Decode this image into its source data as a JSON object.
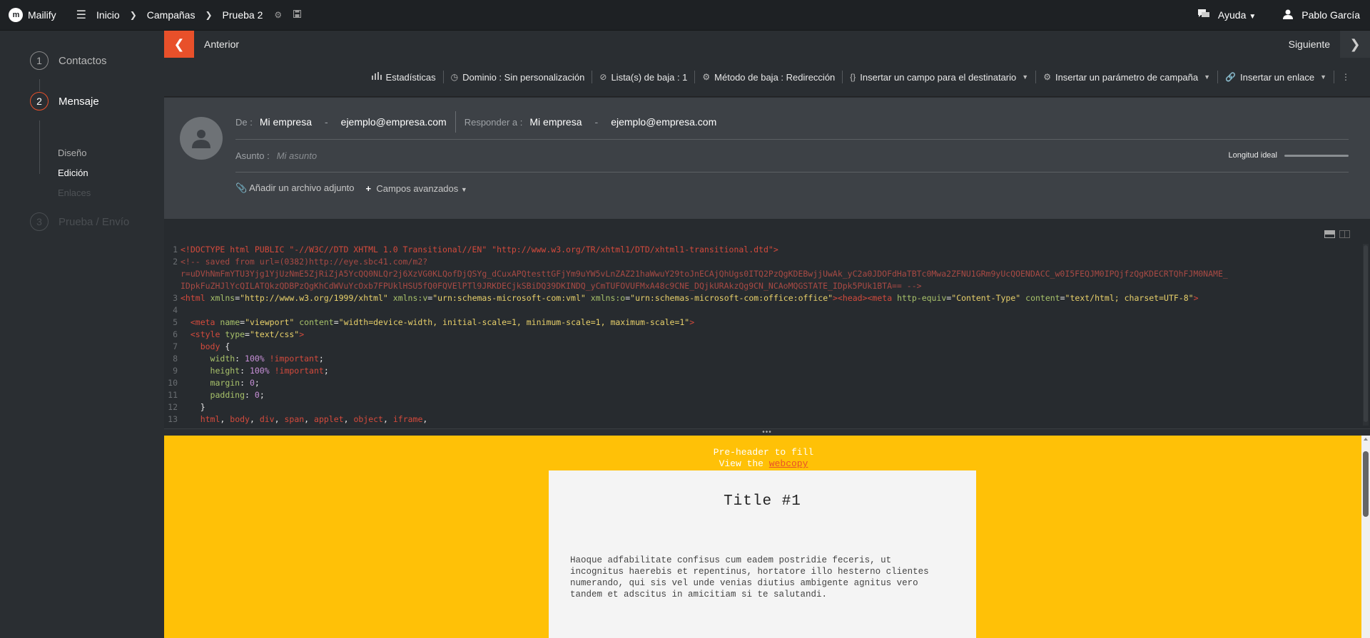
{
  "app": {
    "name": "Mailify"
  },
  "breadcrumb": [
    "Inicio",
    "Campañas",
    "Prueba 2"
  ],
  "topright": {
    "help": "Ayuda",
    "user": "Pablo García"
  },
  "sidebar": {
    "steps": [
      {
        "num": "1",
        "label": "Contactos"
      },
      {
        "num": "2",
        "label": "Mensaje"
      },
      {
        "num": "3",
        "label": "Prueba / Envío"
      }
    ],
    "substeps": [
      "Diseño",
      "Edición",
      "Enlaces"
    ]
  },
  "nav": {
    "prev": "Anterior",
    "next": "Siguiente"
  },
  "toolbar": {
    "stats": "Estadísticas",
    "domain": "Dominio : Sin personalización",
    "lists": "Lista(s) de baja : 1",
    "method": "Método de baja : Redirección",
    "insert_field": "Insertar un campo para el destinatario",
    "insert_param": "Insertar un parámetro de campaña",
    "insert_link": "Insertar un enlace"
  },
  "header": {
    "from_label": "De :",
    "from_name": "Mi empresa",
    "from_email": "ejemplo@empresa.com",
    "reply_label": "Responder a :",
    "reply_name": "Mi empresa",
    "reply_email": "ejemplo@empresa.com",
    "subject_label": "Asunto :",
    "subject_placeholder": "Mi asunto",
    "ideal_length": "Longitud ideal",
    "attach": "Añadir un archivo adjunto",
    "advanced": "Campos avanzados"
  },
  "code": {
    "line1": "<!DOCTYPE html PUBLIC \"-//W3C//DTD XHTML 1.0 Transitional//EN\" \"http://www.w3.org/TR/xhtml1/DTD/xhtml1-transitional.dtd\">",
    "line2a": "<!-- saved from url=(0382)http://eye.sbc41.com/m2?",
    "line2b": "r=uDVhNmFmYTU3Yjg1YjUzNmE5ZjRiZjA5YcQQ0NLQr2j6XzVG0KLQofDjQSYg_dCuxAPQtesttGFjYm9uYW5vLnZAZ21haWwuY29toJnECAjQhUgs0ITQ2PzQgKDEBwjjUwAk_yC2a0JDOFdHaTBTc0Mwa2ZFNU1GRm9yUcQOENDACC_w0I5FEQJM0IPQjfzQgKDECRTQhFJM0NAME_",
    "line2c": "IDpkFuZHJlYcQILATQkzQDBPzQgKhCdWVuYcOxb7FPUklHSU5fQ0FQVElPTl9JRKDECjkSBiDQ39DKINDQ_yCmTUFOVUFMxA48c9CNE_DQjkURAkzQg9CN_NCAoMQGSTATE_IDpk5PUk1BTA== -->",
    "line5": "<meta name=\"viewport\" content=\"width=device-width, initial-scale=1, minimum-scale=1, maximum-scale=1\">"
  },
  "preview": {
    "preheader": "Pre-header to fill",
    "view_prefix": "View the ",
    "view_link": "webcopy",
    "title": "Title #1",
    "body": "Haoque adfabilitate confisus cum eadem postridie feceris, ut incognitus haerebis et repentinus, hortatore illo hesterno clientes numerando, qui sis vel unde venias diutius ambigente agnitus vero tandem et adscitus in amicitiam si te salutandi."
  },
  "colors": {
    "accent": "#e8502a",
    "preview_bg": "#ffc107"
  }
}
